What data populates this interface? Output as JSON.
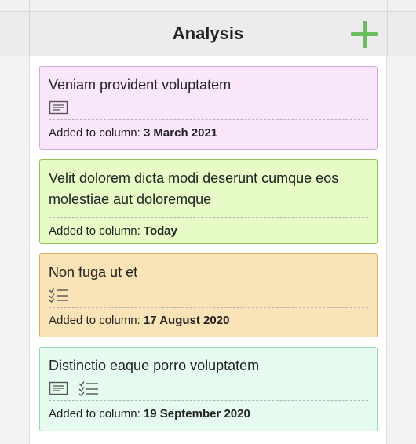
{
  "column": {
    "title": "Analysis",
    "add_icon": "plus-icon",
    "accent_color": "#6cbd5f"
  },
  "cards": [
    {
      "title": "Veniam provident voluptatem",
      "icons": [
        "description-icon"
      ],
      "added_label": "Added to column:",
      "added_date": "3 March 2021",
      "background": "#f9e6fb",
      "border": "#d8a7e0"
    },
    {
      "title": "Velit dolorem dicta modi deserunt cumque eos molestiae aut doloremque",
      "icons": [],
      "added_label": "Added to column:",
      "added_date": "Today",
      "background": "#e6fbc5",
      "border": "#8fc24f"
    },
    {
      "title": "Non fuga ut et",
      "icons": [
        "checklist-icon"
      ],
      "added_label": "Added to column:",
      "added_date": "17 August 2020",
      "background": "#fae3b6",
      "border": "#e0b062"
    },
    {
      "title": "Distinctio eaque porro voluptatem",
      "icons": [
        "description-icon",
        "checklist-icon"
      ],
      "added_label": "Added to column:",
      "added_date": "19 September 2020",
      "background": "#e4fbee",
      "border": "#9ad7b5"
    }
  ]
}
